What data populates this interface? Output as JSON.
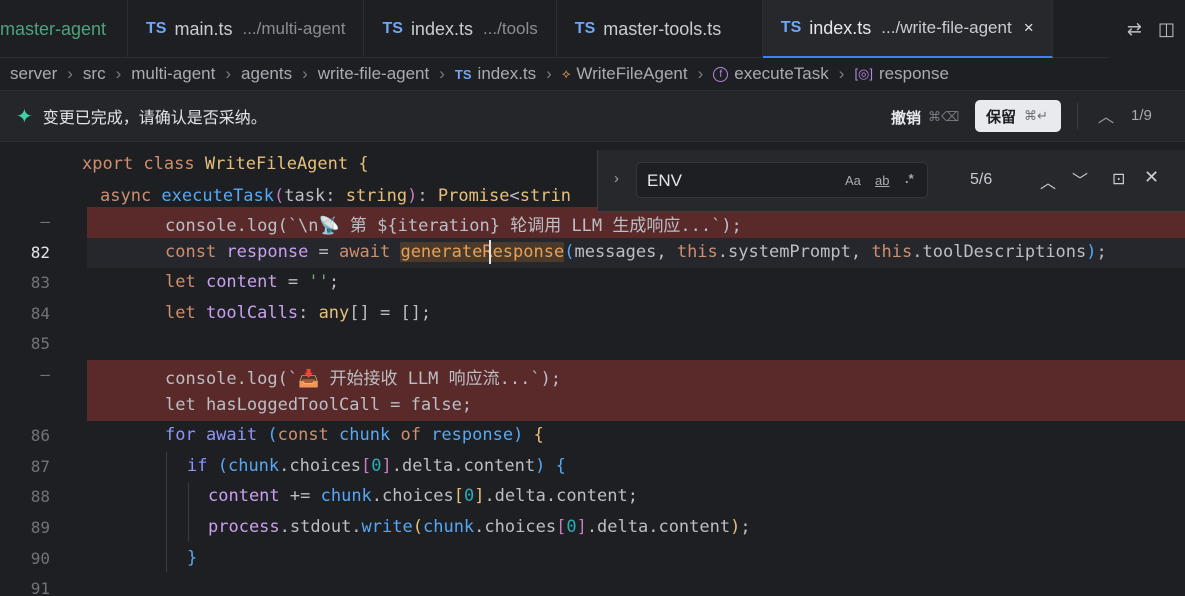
{
  "tabs": [
    {
      "label": "master-agent",
      "prefix": "",
      "path": ""
    },
    {
      "label": "main.ts",
      "prefix": "TS",
      "path": ".../multi-agent"
    },
    {
      "label": "index.ts",
      "prefix": "TS",
      "path": ".../tools"
    },
    {
      "label": "master-tools.ts",
      "prefix": "TS",
      "path": ""
    },
    {
      "label": "index.ts",
      "prefix": "TS",
      "path": ".../write-file-agent",
      "close": "×"
    }
  ],
  "breadcrumb": [
    "server",
    "src",
    "multi-agent",
    "agents",
    "write-file-agent",
    "index.ts",
    "WriteFileAgent",
    "executeTask",
    "response"
  ],
  "breadcrumb_icons": {
    "ts": "TS",
    "cls": "⟡",
    "fn": "f",
    "var": "[◎]"
  },
  "notice": {
    "message": "变更已完成，请确认是否采纳。",
    "undo_label": "撤销",
    "undo_shortcut": "⌘⌫",
    "keep_label": "保留",
    "keep_shortcut": "⌘↵",
    "counter": "1/9"
  },
  "find": {
    "query": "ENV",
    "match_case": "Aa",
    "whole_word": "ab",
    "regex": ".*",
    "result": "5/6"
  },
  "sticky": {
    "line1": "export class WriteFileAgent {",
    "line2": "async executeTask(task: string): Promise<strin"
  },
  "line_numbers": {
    "l82": "82",
    "l83": "83",
    "l84": "84",
    "l85": "85",
    "l86": "86",
    "l87": "87",
    "l88": "88",
    "l89": "89",
    "l90": "90",
    "l91": "91",
    "removed_marker": "—"
  },
  "code": {
    "removed1": "console.log(`\\n📡 第 ${iteration} 轮调用 LLM 生成响应...`);",
    "removed2": "console.log(`📥 开始接收 LLM 响应流...`);",
    "removed3": "let hasLoggedToolCall = false;"
  }
}
